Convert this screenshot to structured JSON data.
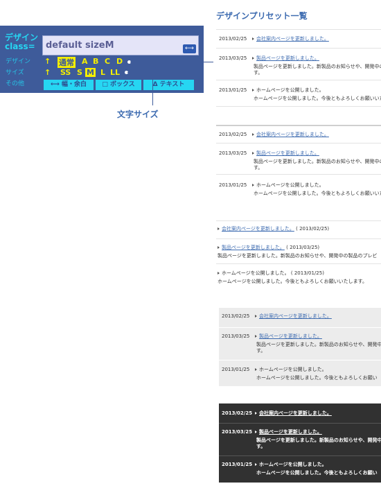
{
  "title": "デザインプリセット一覧",
  "panel": {
    "class_label": "デザインclass=",
    "class_value": "default sizeM",
    "copy_icon": "swap-arrows-icon",
    "side_labels": [
      "デザイン",
      "サイズ",
      "その他"
    ],
    "design_options": [
      "通常",
      "A",
      "B",
      "C",
      "D"
    ],
    "design_selected": "通常",
    "size_options": [
      "SS",
      "S",
      "M",
      "L",
      "LL"
    ],
    "size_selected": "M",
    "buttons": [
      "⟷ 幅・余白",
      "□ ボックス",
      "Δ テキスト"
    ],
    "callout": "文字サイズ",
    "colors": {
      "panel_bg": "#3e5b9a",
      "accent_yellow": "#f4ee00",
      "accent_cyan": "#26d6f2"
    }
  },
  "variant1": {
    "items": [
      {
        "date": "2013/02/25",
        "link": "会社案内ページを更新しました。",
        "text": ""
      },
      {
        "date": "2013/03/25",
        "link": "製品ページを更新しました。",
        "text": "製品ページを更新しました。新製品のお知らせや、開発中の",
        "text2": "す。"
      },
      {
        "date": "2013/01/25",
        "link": "ホームページを公開しました。",
        "text": "ホームページを公開しました。今後ともよろしくお願いいた"
      }
    ]
  },
  "variant2": {
    "items": [
      {
        "date": "2013/02/25",
        "link": "会社案内ページを更新しました。",
        "text": ""
      },
      {
        "date": "2013/03/25",
        "link": "製品ページを更新しました。",
        "text": "製品ページを更新しました。新製品のお知らせや、開発中の",
        "text2": "す。"
      },
      {
        "date": "2013/01/25",
        "link": "ホームページを公開しました。",
        "text": "ホームページを公開しました。今後ともよろしくお願いいた"
      }
    ]
  },
  "variant3": {
    "items": [
      {
        "link": "会社案内ページを更新しました。",
        "date": "( 2013/02/25)",
        "text": ""
      },
      {
        "link": "製品ページを更新しました。",
        "date": "( 2013/03/25)",
        "text": "製品ページを更新しました。新製品のお知らせや、開発中の製品のプレビ"
      },
      {
        "link": "ホームページを公開しました。",
        "date": "( 2013/01/25)",
        "text": "ホームページを公開しました。今後ともよろしくお願いいたします。"
      }
    ]
  },
  "variant4": {
    "items": [
      {
        "date": "2013/02/25",
        "link": "会社案内ページを更新しました。",
        "text": ""
      },
      {
        "date": "2013/03/25",
        "link": "製品ページを更新しました。",
        "text": "製品ページを更新しました。新製品のお知らせや、開発中",
        "text2": "す。"
      },
      {
        "date": "2013/01/25",
        "link": "ホームページを公開しました。",
        "text": "ホームページを公開しました。今後ともよろしくお願い"
      }
    ]
  },
  "variant5": {
    "items": [
      {
        "date": "2013/02/25",
        "link": "会社案内ページを更新しました。",
        "text": ""
      },
      {
        "date": "2013/03/25",
        "link": "製品ページを更新しました。",
        "text": "製品ページを更新しました。新製品のお知らせや、開発中",
        "text2": "す。"
      },
      {
        "date": "2013/01/25",
        "link": "ホームページを公開しました。",
        "text": "ホームページを公開しました。今後ともよろしくお願い"
      }
    ]
  }
}
